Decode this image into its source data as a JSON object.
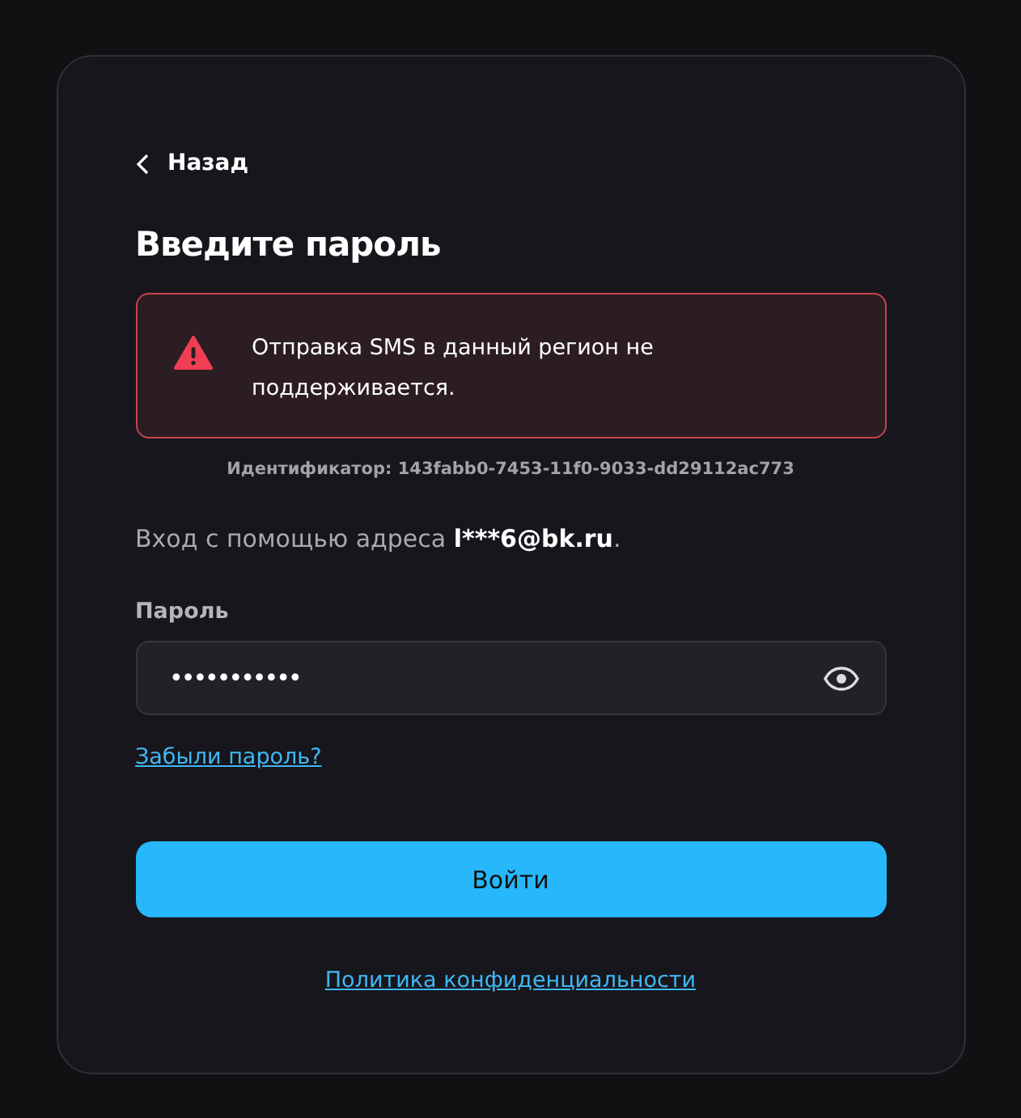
{
  "back": {
    "label": "Назад"
  },
  "title": "Введите пароль",
  "alert": {
    "message": "Отправка SMS в данный регион не поддерживается."
  },
  "identifier": "Идентификатор: 143fabb0-7453-11f0-9033-dd29112ac773",
  "login_hint": {
    "text": "Вход с помощью адреса ",
    "email": "l***6@bk.ru",
    "suffix": "."
  },
  "password": {
    "label": "Пароль",
    "value": "•••••••••••"
  },
  "forgot_link": "Забыли пароль?",
  "submit_button": "Войти",
  "privacy_link": "Политика конфиденциальности"
}
